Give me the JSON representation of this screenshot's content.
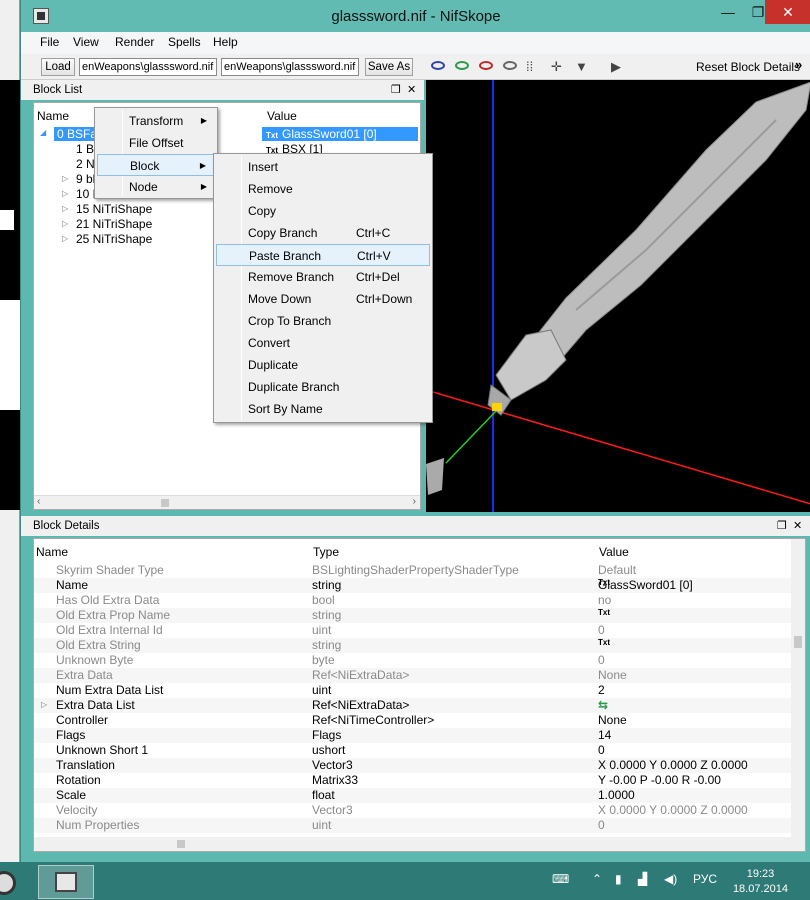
{
  "window": {
    "title": "glasssword.nif - NifSkope"
  },
  "menubar": {
    "items": [
      "File",
      "View",
      "Render",
      "Spells",
      "Help"
    ]
  },
  "toolbar": {
    "load_label": "Load",
    "path_field_1": "enWeapons\\glasssword.nif",
    "path_field_2": "enWeapons\\glasssword.nif",
    "save_as_label": "Save As",
    "reset_label": "Reset Block Details",
    "overflow": "»"
  },
  "block_list": {
    "title": "Block List",
    "col_name": "Name",
    "col_value": "Value",
    "rows": [
      {
        "name": "0 BSFadeNode",
        "value": "GlassSword01 [0]"
      },
      {
        "name": "1 BSXFlags",
        "value": "BSX [1]"
      },
      {
        "name": "2 NiStringExtraData",
        "value": ""
      },
      {
        "name": "9 bhkCollisionObject",
        "value": ""
      },
      {
        "name": "10 NiTriShape",
        "value": ""
      },
      {
        "name": "15 NiTriShape",
        "value": ""
      },
      {
        "name": "21 NiTriShape",
        "value": ""
      },
      {
        "name": "25 NiTriShape",
        "value": ""
      }
    ]
  },
  "context_menu": {
    "items": [
      "Transform",
      "File Offset",
      "Block",
      "Node"
    ]
  },
  "block_submenu": {
    "items": [
      {
        "label": "Insert",
        "shortcut": ""
      },
      {
        "label": "Remove",
        "shortcut": ""
      },
      {
        "label": "Copy",
        "shortcut": ""
      },
      {
        "label": "Copy Branch",
        "shortcut": "Ctrl+C"
      },
      {
        "label": "Paste Branch",
        "shortcut": "Ctrl+V"
      },
      {
        "label": "Remove Branch",
        "shortcut": "Ctrl+Del"
      },
      {
        "label": "Move Down",
        "shortcut": "Ctrl+Down"
      },
      {
        "label": "Crop To Branch",
        "shortcut": ""
      },
      {
        "label": "Convert",
        "shortcut": ""
      },
      {
        "label": "Duplicate",
        "shortcut": ""
      },
      {
        "label": "Duplicate Branch",
        "shortcut": ""
      },
      {
        "label": "Sort By Name",
        "shortcut": ""
      }
    ]
  },
  "block_details": {
    "title": "Block Details",
    "col_name": "Name",
    "col_type": "Type",
    "col_value": "Value",
    "rows": [
      {
        "name": "Skyrim Shader Type",
        "type": "BSLightingShaderPropertyShaderType",
        "value": "Default"
      },
      {
        "name": "Name",
        "type": "string",
        "value": "GlassSword01 [0]"
      },
      {
        "name": "Has Old Extra Data",
        "type": "bool",
        "value": "no"
      },
      {
        "name": "Old Extra Prop Name",
        "type": "string",
        "value": ""
      },
      {
        "name": "Old Extra Internal Id",
        "type": "uint",
        "value": "0"
      },
      {
        "name": "Old Extra String",
        "type": "string",
        "value": ""
      },
      {
        "name": "Unknown Byte",
        "type": "byte",
        "value": "0"
      },
      {
        "name": "Extra Data",
        "type": "Ref<NiExtraData>",
        "value": "None"
      },
      {
        "name": "Num Extra Data List",
        "type": "uint",
        "value": "2"
      },
      {
        "name": "Extra Data List",
        "type": "Ref<NiExtraData>",
        "value": ""
      },
      {
        "name": "Controller",
        "type": "Ref<NiTimeController>",
        "value": "None"
      },
      {
        "name": "Flags",
        "type": "Flags",
        "value": "14"
      },
      {
        "name": "Unknown Short 1",
        "type": "ushort",
        "value": "0"
      },
      {
        "name": "Translation",
        "type": "Vector3",
        "value": "X 0.0000 Y 0.0000 Z 0.0000"
      },
      {
        "name": "Rotation",
        "type": "Matrix33",
        "value": "Y -0.00 P -0.00 R -0.00"
      },
      {
        "name": "Scale",
        "type": "float",
        "value": "1.0000"
      },
      {
        "name": "Velocity",
        "type": "Vector3",
        "value": "X 0.0000 Y 0.0000 Z 0.0000"
      },
      {
        "name": "Num Properties",
        "type": "uint",
        "value": "0"
      }
    ]
  },
  "taskbar": {
    "lang": "РУС",
    "time": "19:23",
    "date": "18.07.2014"
  },
  "colors": {
    "titlebar": "#62bbb3",
    "taskbar": "#2d7a76",
    "selection": "#3399ff",
    "close": "#c7312b"
  }
}
